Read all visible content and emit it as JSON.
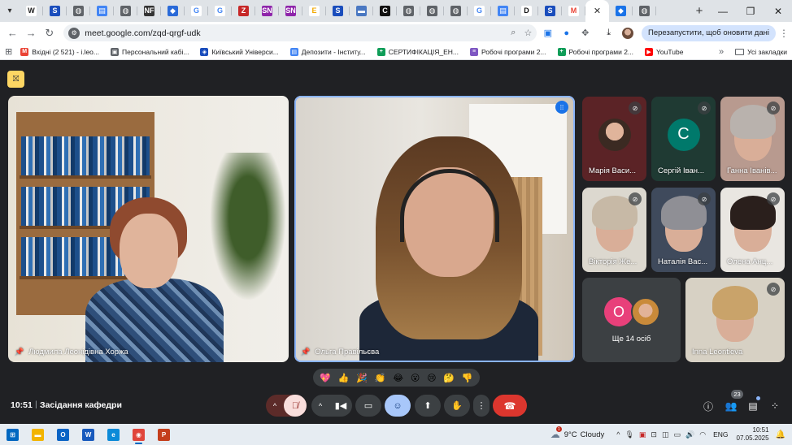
{
  "browser": {
    "tabs": [
      {
        "icon": "W",
        "color": "#ffffff",
        "fg": "#222"
      },
      {
        "icon": "S",
        "color": "#1a4dbc"
      },
      {
        "icon": "◍",
        "color": "#5f6368"
      },
      {
        "icon": "▤",
        "color": "#4285f4"
      },
      {
        "icon": "◍",
        "color": "#5f6368"
      },
      {
        "icon": "NF",
        "color": "#333333"
      },
      {
        "icon": "◆",
        "color": "#2a6ad8"
      },
      {
        "icon": "G",
        "color": "#ffffff",
        "fg": "#4285f4"
      },
      {
        "icon": "G",
        "color": "#ffffff",
        "fg": "#4285f4"
      },
      {
        "icon": "Z",
        "color": "#c62828"
      },
      {
        "icon": "SN",
        "color": "#8e24aa"
      },
      {
        "icon": "SN",
        "color": "#8e24aa"
      },
      {
        "icon": "E",
        "color": "#ffffff",
        "fg": "#f2a900"
      },
      {
        "icon": "S",
        "color": "#1a4dbc"
      },
      {
        "icon": "▬",
        "color": "#4a78c2"
      },
      {
        "icon": "C",
        "color": "#111111"
      },
      {
        "icon": "◍",
        "color": "#5f6368"
      },
      {
        "icon": "◍",
        "color": "#5f6368"
      },
      {
        "icon": "◍",
        "color": "#5f6368"
      },
      {
        "icon": "G",
        "color": "#ffffff",
        "fg": "#4285f4"
      },
      {
        "icon": "▤",
        "color": "#4285f4"
      },
      {
        "icon": "D",
        "color": "#ffffff",
        "fg": "#111"
      },
      {
        "icon": "S",
        "color": "#1a4dbc"
      },
      {
        "icon": "M",
        "color": "#ffffff",
        "fg": "#ea4335"
      }
    ],
    "active_tab_close": "✕",
    "after_tabs": [
      {
        "icon": "◆",
        "color": "#1a73e8"
      },
      {
        "icon": "◍",
        "color": "#5f6368"
      }
    ],
    "new_tab": "+",
    "win_min": "—",
    "win_max": "❐",
    "win_close": "✕",
    "url": "meet.google.com/zqd-qrgf-udk",
    "update_label": "Перезапустити, щоб оновити дані",
    "bookmarks": [
      {
        "label": "Вхідні (2 521) - i.leo...",
        "color": "#ea4335",
        "icon": "M"
      },
      {
        "label": "Персональний кабі...",
        "color": "#5f6368",
        "icon": "▣"
      },
      {
        "label": "Київський Універси...",
        "color": "#1a4dbc",
        "icon": "◈"
      },
      {
        "label": "Депозити - Інститу...",
        "color": "#4285f4",
        "icon": "▤"
      },
      {
        "label": "СЕРТИФІКАЦІЯ_ЕН...",
        "color": "#0f9d58",
        "icon": "+"
      },
      {
        "label": "Робочі програми 2...",
        "color": "#7e57c2",
        "icon": "≡"
      },
      {
        "label": "Робочі програми 2...",
        "color": "#0f9d58",
        "icon": "+"
      },
      {
        "label": "YouTube",
        "color": "#ff0000",
        "icon": "▶"
      }
    ],
    "bookmarks_more": "»",
    "all_bookmarks": "Усі закладки"
  },
  "meet": {
    "main_tiles": [
      {
        "name": "Людмила Леонідівна Хоржа"
      },
      {
        "name": "Ольга Правільєва"
      }
    ],
    "side_tiles": [
      {
        "name": "Марія Васи...",
        "type": "photo-avatar",
        "bg": "#5b2326"
      },
      {
        "name": "Сергій Іван...",
        "type": "letter-avatar",
        "letter": "С",
        "bg": "#1f3a33"
      },
      {
        "name": "Ганна Іванів...",
        "type": "video",
        "bg": "#b89a8f",
        "hair": "#b9b2ad"
      },
      {
        "name": "Вікторія Же...",
        "type": "video",
        "bg": "#dcd8cf",
        "hair": "#c7b9a6"
      },
      {
        "name": "Наталія Вас...",
        "type": "video",
        "bg": "#3f4a5c",
        "hair": "#8f8f95"
      },
      {
        "name": "Олена Анц...",
        "type": "video",
        "bg": "#e9e6e1",
        "hair": "#2a1f1c"
      },
      {
        "name": "Inna Leontieva",
        "type": "video",
        "bg": "#d7d1c4",
        "hair": "#c9a36a"
      }
    ],
    "more": {
      "label": "Ще 14 осіб",
      "letter": "О"
    },
    "reactions": [
      "💖",
      "👍",
      "🎉",
      "👏",
      "😂",
      "😮",
      "😢",
      "🤔",
      "👎"
    ],
    "time": "10:51",
    "separator": "|",
    "title": "Засідання кафедри",
    "people_count": "23"
  },
  "taskbar": {
    "apps": [
      {
        "icon": "⊞",
        "color": "#0067c0",
        "name": "start"
      },
      {
        "icon": "▬",
        "color": "#f2b400",
        "name": "explorer"
      },
      {
        "icon": "O",
        "color": "#0a64c5",
        "name": "outlook"
      },
      {
        "icon": "W",
        "color": "#185abd",
        "name": "word"
      },
      {
        "icon": "e",
        "color": "#0c8ad8",
        "name": "edge"
      },
      {
        "icon": "◉",
        "color": "#e0453b",
        "name": "chrome"
      },
      {
        "icon": "P",
        "color": "#c43e1c",
        "name": "powerpoint"
      }
    ],
    "weather_temp": "9°C",
    "weather_desc": "Cloudy",
    "weather_badge": "1",
    "lang": "ENG",
    "time": "10:51",
    "date": "07.05.2025"
  }
}
